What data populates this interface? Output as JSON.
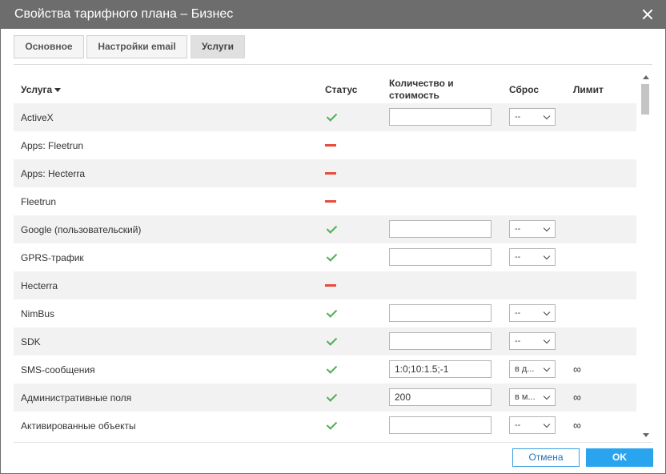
{
  "dialog": {
    "title": "Свойства тарифного плана – Бизнес"
  },
  "tabs": [
    {
      "label": "Основное",
      "active": false
    },
    {
      "label": "Настройки email",
      "active": false
    },
    {
      "label": "Услуги",
      "active": true
    }
  ],
  "table": {
    "headers": {
      "service": "Услуга",
      "status": "Статус",
      "qty_line1": "Количество и",
      "qty_line2": "стоимость",
      "reset": "Сброс",
      "limit": "Лимит"
    },
    "rows": [
      {
        "name": "ActiveX",
        "status": "on",
        "qty": "",
        "reset": "--",
        "limit": ""
      },
      {
        "name": "Apps: Fleetrun",
        "status": "off"
      },
      {
        "name": "Apps: Hecterra",
        "status": "off"
      },
      {
        "name": "Fleetrun",
        "status": "off"
      },
      {
        "name": "Google (пользовательский)",
        "status": "on",
        "qty": "",
        "reset": "--",
        "limit": ""
      },
      {
        "name": "GPRS-трафик",
        "status": "on",
        "qty": "",
        "reset": "--",
        "limit": ""
      },
      {
        "name": "Hecterra",
        "status": "off"
      },
      {
        "name": "NimBus",
        "status": "on",
        "qty": "",
        "reset": "--",
        "limit": ""
      },
      {
        "name": "SDK",
        "status": "on",
        "qty": "",
        "reset": "--",
        "limit": ""
      },
      {
        "name": "SMS-сообщения",
        "status": "on",
        "qty": "1:0;10:1.5;-1",
        "reset": "в д...",
        "limit": "∞"
      },
      {
        "name": "Административные поля",
        "status": "on",
        "qty": "200",
        "reset": "в м...",
        "limit": "∞"
      },
      {
        "name": "Активированные объекты",
        "status": "on",
        "qty": "",
        "reset": "--",
        "limit": "∞"
      }
    ]
  },
  "footer": {
    "cancel_label": "Отмена",
    "ok_label": "OK"
  },
  "colors": {
    "titlebar": "#6d6d6d",
    "ok": "#2aa4ee",
    "check": "#4caf50",
    "dash": "#e84a3c"
  }
}
